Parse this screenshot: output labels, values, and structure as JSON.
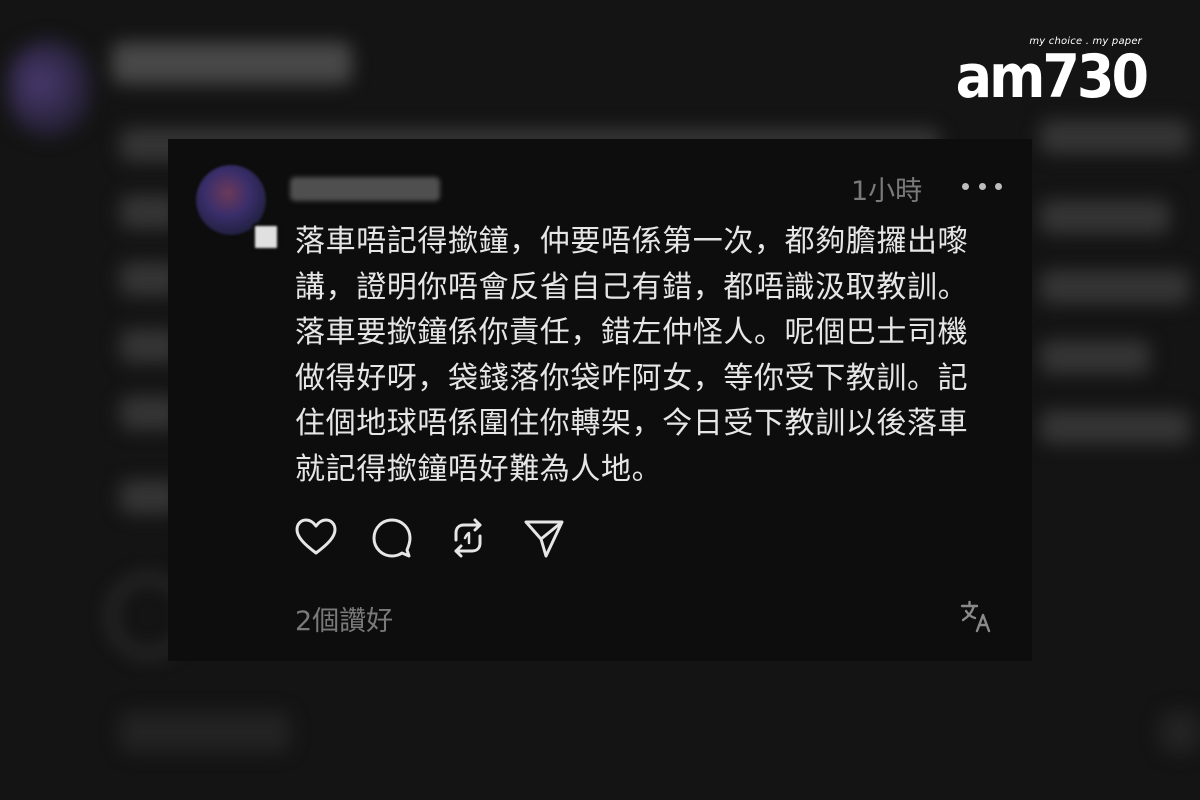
{
  "logo": {
    "tagline": "my choice . my paper",
    "text": "am730"
  },
  "post": {
    "username": "threadsuser",
    "timestamp": "1小時",
    "text_lines": [
      "落車唔記得撳鐘，仲要唔係第一次，都夠膽攞出嚟",
      "講，證明你唔會反省自己有錯，都唔識汲取教訓。",
      "落車要撳鐘係你責任，錯左仲怪人。呢個巴士司機",
      "做得好呀，袋錢落你袋咋阿女，等你受下教訓。記",
      "住個地球唔係圍住你轉架，今日受下教訓以後落車",
      "就記得撳鐘唔好難為人地。"
    ],
    "likes": "2個讚好",
    "icons": {
      "more": "more-horizontal-icon",
      "like": "heart-icon",
      "comment": "comment-bubble-icon",
      "repost": "repost-icon",
      "share": "send-icon",
      "translate": "translate-icon"
    }
  },
  "colors": {
    "card_background": "#0d0d0d",
    "text": "#e6e6e6",
    "muted": "#7a7a7a",
    "icon": "#e6e6e6"
  }
}
